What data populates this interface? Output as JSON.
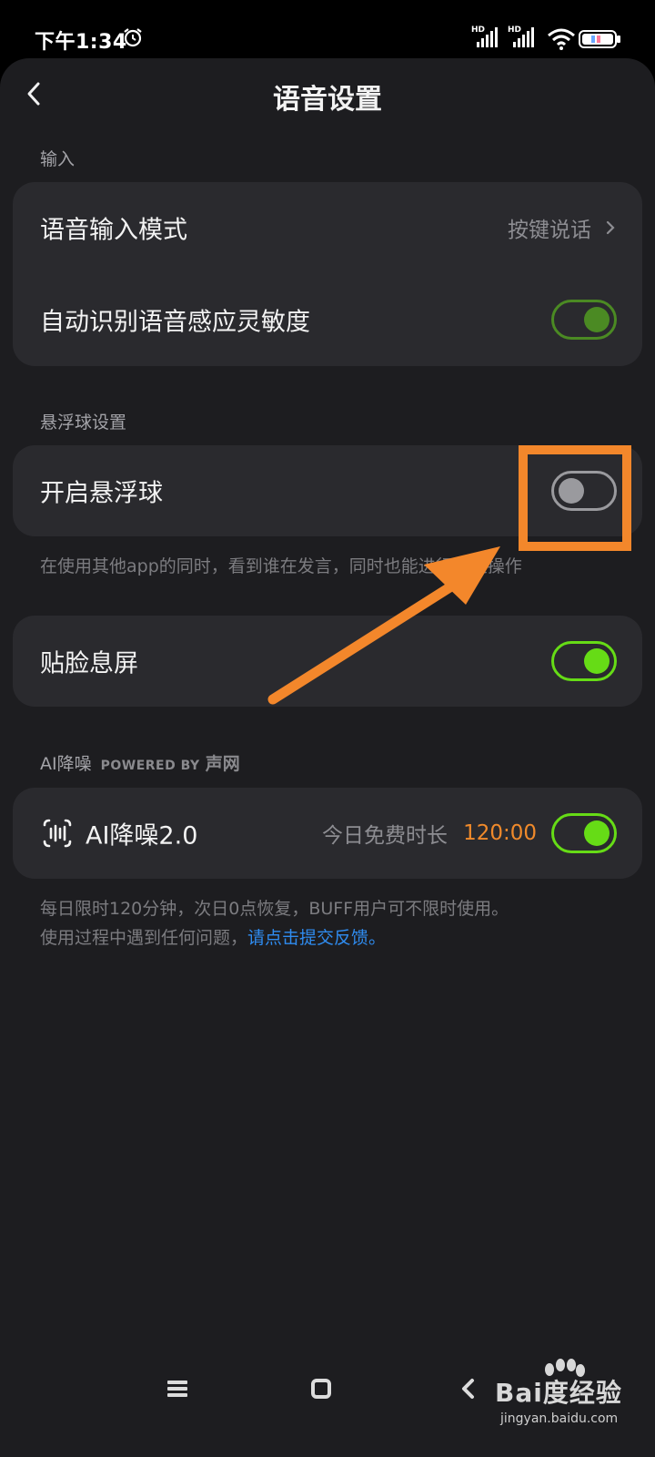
{
  "status_bar": {
    "time": "下午1:34",
    "icons": [
      "alarm-icon",
      "signal-hd-icon",
      "signal-hd-icon",
      "wifi-icon",
      "battery-icon"
    ]
  },
  "header": {
    "title": "语音设置",
    "back_icon": "back-chevron-icon"
  },
  "input_section": {
    "label": "输入",
    "rows": [
      {
        "label": "语音输入模式",
        "value": "按键说话"
      },
      {
        "label": "自动识别语音感应灵敏度",
        "toggle": "on"
      }
    ]
  },
  "float_section": {
    "label": "悬浮球设置",
    "row": {
      "label": "开启悬浮球",
      "toggle": "off"
    },
    "hint": "在使用其他app的同时，看到谁在发言，同时也能进行快速操作"
  },
  "face_row": {
    "label": "贴脸息屏",
    "toggle": "on"
  },
  "ai_section": {
    "label": "AI降噪",
    "powered_by": "POWERED BY",
    "brand": "声网",
    "row": {
      "title": "AI降噪2.0",
      "free_label": "今日免费时长",
      "free_time": "120:00",
      "toggle": "on"
    },
    "hint_line1": "每日限时120分钟，次日0点恢复，BUFF用户可不限时使用。",
    "hint_line2_prefix": "使用过程中遇到任何问题，",
    "hint_link": "请点击提交反馈。"
  },
  "nav_bar": {
    "icons": [
      "menu-icon",
      "home-icon",
      "back-icon"
    ]
  },
  "watermark": {
    "text": "Bai度经验",
    "url": "jingyan.baidu.com"
  },
  "colors": {
    "background": "#1d1d20",
    "card": "#2a2a2e",
    "toggle_on": "#66dc16",
    "accent_orange": "#f3872b",
    "link": "#2f8cf0"
  }
}
